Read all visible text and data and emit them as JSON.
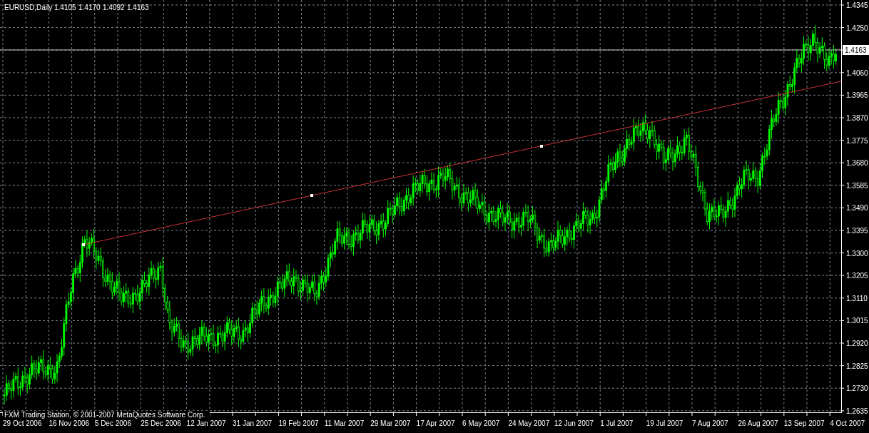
{
  "chart_header": {
    "symbol": "EURUSD,Daily",
    "quotes": [
      "1.4105",
      "1.4170",
      "1.4092",
      "1.4163"
    ]
  },
  "price_axis": {
    "labels": [
      "1.4345",
      "1.4250",
      "1.4060",
      "1.3965",
      "1.3870",
      "1.3775",
      "1.3680",
      "1.3585",
      "1.3490",
      "1.3395",
      "1.3300",
      "1.3205",
      "1.3110",
      "1.3015",
      "1.2920",
      "1.2825",
      "1.2730",
      "1.2635"
    ],
    "current_price": "1.4163"
  },
  "time_axis": {
    "labels": [
      "29 Oct 2006",
      "16 Nov 2006",
      "5 Dec 2006",
      "25 Dec 2006",
      "12 Jan 2007",
      "31 Jan 2007",
      "19 Feb 2007",
      "11 Mar 2007",
      "29 Mar 2007",
      "17 Apr 2007",
      "6 May 2007",
      "24 May 2007",
      "12 Jun 2007",
      "1 Jul 2007",
      "19 Jul 2007",
      "7 Aug 2007",
      "26 Aug 2007",
      "13 Sep 2007",
      "4 Oct 2007"
    ]
  },
  "copyright": "FXM Trading Station, © 2001-2007 MetaQuotes Software Corp."
}
